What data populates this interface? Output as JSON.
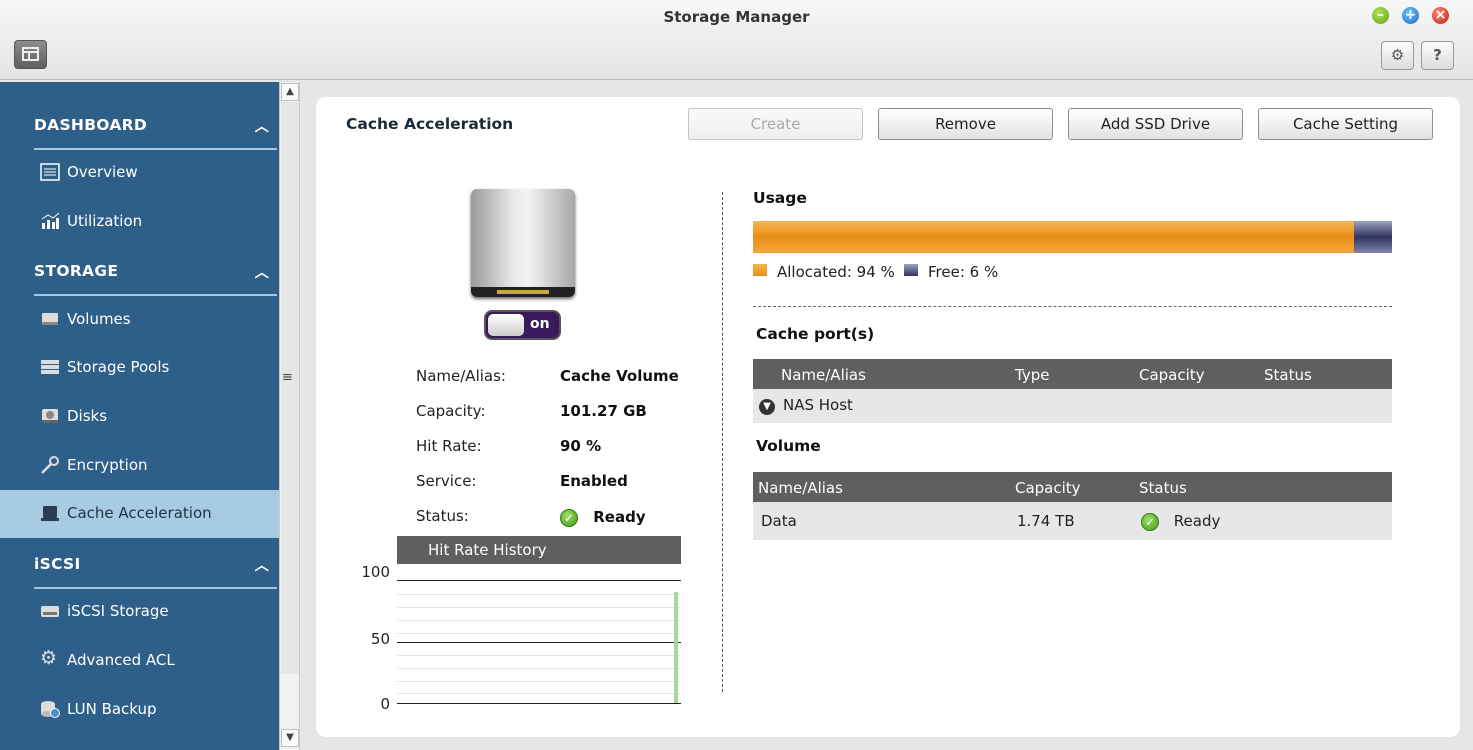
{
  "window": {
    "title": "Storage Manager"
  },
  "sidebar": {
    "sections": [
      {
        "label": "DASHBOARD",
        "items": [
          {
            "label": "Overview"
          },
          {
            "label": "Utilization"
          }
        ]
      },
      {
        "label": "STORAGE",
        "items": [
          {
            "label": "Volumes"
          },
          {
            "label": "Storage Pools"
          },
          {
            "label": "Disks"
          },
          {
            "label": "Encryption"
          },
          {
            "label": "Cache Acceleration"
          }
        ]
      },
      {
        "label": "iSCSI",
        "items": [
          {
            "label": "iSCSI Storage"
          },
          {
            "label": "Advanced ACL"
          },
          {
            "label": "LUN Backup"
          }
        ]
      }
    ],
    "active_item": "Cache Acceleration"
  },
  "main": {
    "title": "Cache Acceleration",
    "buttons": {
      "create": "Create",
      "remove": "Remove",
      "add_ssd": "Add SSD Drive",
      "cache_setting": "Cache Setting"
    },
    "toggle": {
      "label": "on",
      "state": true
    },
    "info": {
      "name_label": "Name/Alias:",
      "name_value": "Cache Volume",
      "capacity_label": "Capacity:",
      "capacity_value": "101.27 GB",
      "hitrate_label": "Hit Rate:",
      "hitrate_value": "90 %",
      "service_label": "Service:",
      "service_value": "Enabled",
      "status_label": "Status:",
      "status_value": "Ready"
    },
    "hit_rate_history": {
      "title": "Hit Rate History",
      "y_ticks": [
        "100",
        "50",
        "0"
      ],
      "latest_value": 90
    },
    "usage": {
      "title": "Usage",
      "allocated_label": "Allocated: 94 %",
      "free_label": "Free: 6 %",
      "allocated_percent": 94,
      "free_percent": 6,
      "colors": {
        "allocated": "#e98e19",
        "free": "#30335c"
      }
    },
    "cache_ports": {
      "title": "Cache port(s)",
      "columns": [
        "Name/Alias",
        "Type",
        "Capacity",
        "Status"
      ],
      "rows": [
        {
          "name": "NAS Host"
        }
      ]
    },
    "volume": {
      "title": "Volume",
      "columns": [
        "Name/Alias",
        "Capacity",
        "Status"
      ],
      "rows": [
        {
          "name": "Data",
          "capacity": "1.74 TB",
          "status": "Ready"
        }
      ]
    }
  }
}
